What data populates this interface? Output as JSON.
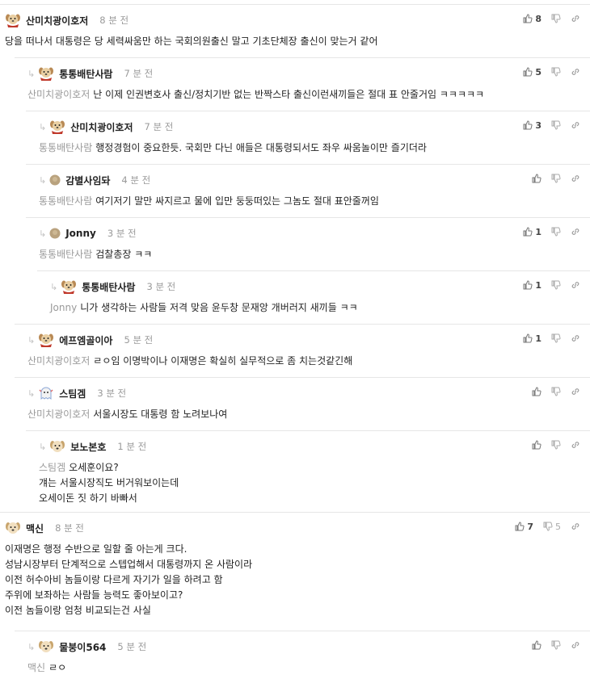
{
  "comments": [
    {
      "name": "산미치광이호저",
      "time": "8 분 전",
      "mention": "",
      "lines": [
        "당을 떠나서 대통령은 당 세력싸움만 하는 국회의원출신 말고 기초단체장 출신이 맞는거 같어"
      ],
      "likes": "8",
      "dislikes": "",
      "avatar": "dog"
    },
    {
      "name": "통통배탄사람",
      "time": "7 분 전",
      "mention": "산미치광이호저",
      "lines": [
        "난 이제 인권변호사 출신/정치기반 없는 반짝스타 출신이런새끼들은 절대 표 안줄거임 ㅋㅋㅋㅋㅋ"
      ],
      "likes": "5",
      "dislikes": "",
      "avatar": "dog"
    },
    {
      "name": "산미치광이호저",
      "time": "7 분 전",
      "mention": "통통배탄사람",
      "lines": [
        "행정경험이 중요한듯. 국회만 다닌 애들은 대통령되서도 좌우 싸움놀이만 즐기더라"
      ],
      "likes": "3",
      "dislikes": "",
      "avatar": "dog"
    },
    {
      "name": "감별사임돠",
      "time": "4 분 전",
      "mention": "통통배탄사람",
      "lines": [
        "여기저기 말만 싸지르고 물에 입만 둥둥떠있는 그놈도 절대 표안줄꺼임"
      ],
      "likes": "",
      "dislikes": "",
      "avatar": "dot"
    },
    {
      "name": "Jonny",
      "time": "3 분 전",
      "mention": "통통배탄사람",
      "lines": [
        "검찰총장 ㅋㅋ"
      ],
      "likes": "1",
      "dislikes": "",
      "avatar": "dot"
    },
    {
      "name": "통통배탄사람",
      "time": "3 분 전",
      "mention": "Jonny",
      "lines": [
        "니가 생각하는 사람들 저격 맞음 윤두창 문재앙 개버러지 새끼들 ㅋㅋ"
      ],
      "likes": "1",
      "dislikes": "",
      "avatar": "dog"
    },
    {
      "name": "에프엠골이아",
      "time": "5 분 전",
      "mention": "산미치광이호저",
      "lines": [
        "ㄹㅇ임 이명박이나 이재명은 확실히 실무적으로 좀 치는것같긴해"
      ],
      "likes": "1",
      "dislikes": "",
      "avatar": "dog"
    },
    {
      "name": "스팀겜",
      "time": "3 분 전",
      "mention": "산미치광이호저",
      "lines": [
        "서울시장도 대통령 함 노려보나여"
      ],
      "likes": "",
      "dislikes": "",
      "avatar": "ghost"
    },
    {
      "name": "보노본호",
      "time": "1 분 전",
      "mention": "스팀겜",
      "lines": [
        "오세훈이요?",
        "걔는 서울시장직도 버거워보이는데",
        "오세이돈 짓 하기 바빠서"
      ],
      "likes": "",
      "dislikes": "",
      "avatar": "puppy"
    },
    {
      "name": "맥신",
      "time": "8 분 전",
      "mention": "",
      "lines": [
        "이재명은 행정 수반으로 일할 줄 아는게 크다.",
        "성남시장부터 단계적으로 스텝업해서 대통령까지 온 사람이라",
        "이전 허수아비 놈들이랑 다르게 자기가 일을 하려고 함",
        "주위에 보좌하는 사람들 능력도 좋아보이고?",
        "이전 놈들이랑 엄청 비교되는건 사실"
      ],
      "likes": "7",
      "dislikes": "5",
      "avatar": "puppy"
    },
    {
      "name": "물붕이564",
      "time": "5 분 전",
      "mention": "맥신",
      "lines": [
        "ㄹㅇ"
      ],
      "likes": "",
      "dislikes": "",
      "avatar": "puppy"
    }
  ]
}
